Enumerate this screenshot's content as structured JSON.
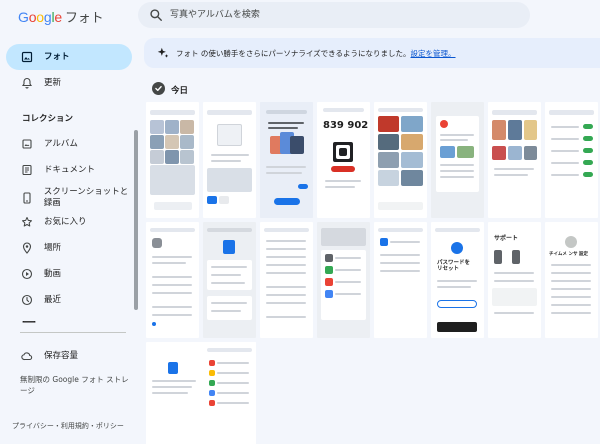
{
  "header": {
    "logo_word": "Google",
    "product_name": "フォト",
    "search_placeholder": "写真やアルバムを検索"
  },
  "sidebar": {
    "items": [
      {
        "label": "フォト",
        "icon": "photo-icon",
        "active": true
      },
      {
        "label": "更新",
        "icon": "bell-icon",
        "active": false
      }
    ],
    "collection_title": "コレクション",
    "collection_items": [
      {
        "label": "アルバム",
        "icon": "album-icon"
      },
      {
        "label": "ドキュメント",
        "icon": "document-icon"
      },
      {
        "label": "スクリーンショットと録画",
        "icon": "screenshot-icon"
      },
      {
        "label": "お気に入り",
        "icon": "star-icon"
      },
      {
        "label": "場所",
        "icon": "location-icon"
      },
      {
        "label": "動画",
        "icon": "play-icon"
      },
      {
        "label": "最近",
        "icon": "clock-icon"
      },
      {
        "label": "ー",
        "icon": ""
      }
    ],
    "storage_label": "保存容量",
    "storage_icon": "cloud-icon",
    "storage_subtext": "無制限の Google フォト ストレージ",
    "footer_links": [
      "プライバシー",
      "利用規約",
      "ポリシー"
    ],
    "footer_separator": "・"
  },
  "banner": {
    "icon": "sparkle-icon",
    "text": "フォト の使い勝手をさらにパーソナライズできるようになりました。",
    "link": "設定を管理。"
  },
  "main": {
    "date_label": "今日",
    "thumb_texts": {
      "code": "839 902",
      "password_title": "パスワードを\nリセット",
      "support_title": "サポート",
      "name_title": "チイムメ ンサ 設定"
    }
  },
  "colors": {
    "accent": "#0b57d0",
    "active_nav": "#c2e7ff",
    "background": "#f3f6fc",
    "banner_bg": "#e6eefc"
  }
}
